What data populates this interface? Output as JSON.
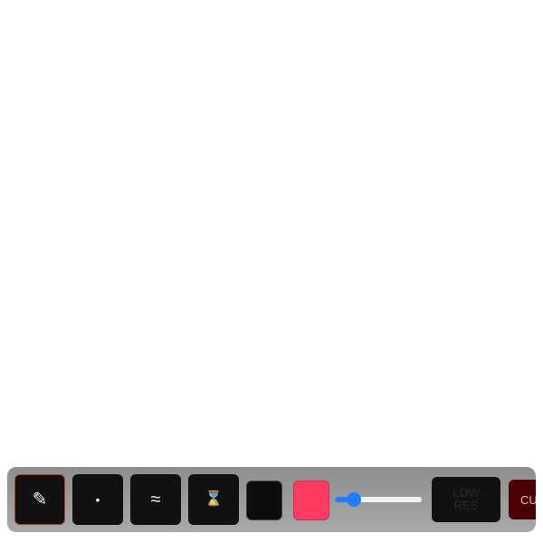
{
  "toolbar": {
    "tools": [
      {
        "name": "pencil-tool",
        "icon": "pencil-icon",
        "glyph": "✎",
        "active": true
      },
      {
        "name": "dot-tool",
        "icon": "dot-icon",
        "glyph": "•",
        "active": false
      },
      {
        "name": "wave-tool",
        "icon": "wave-icon",
        "glyph": "≈",
        "active": false
      },
      {
        "name": "hourglass-tool",
        "icon": "hourglass-icon",
        "glyph": "⌛",
        "active": false
      }
    ],
    "colors": {
      "black": "#0d0d0d",
      "pink": "#ff3b61",
      "accent": "#1e7cff"
    },
    "brush_size": {
      "value_percent": 22
    },
    "low_res": {
      "label_line1": "LOW",
      "label_line2": "RES"
    },
    "cursor": {
      "label": "CURSOR"
    }
  }
}
